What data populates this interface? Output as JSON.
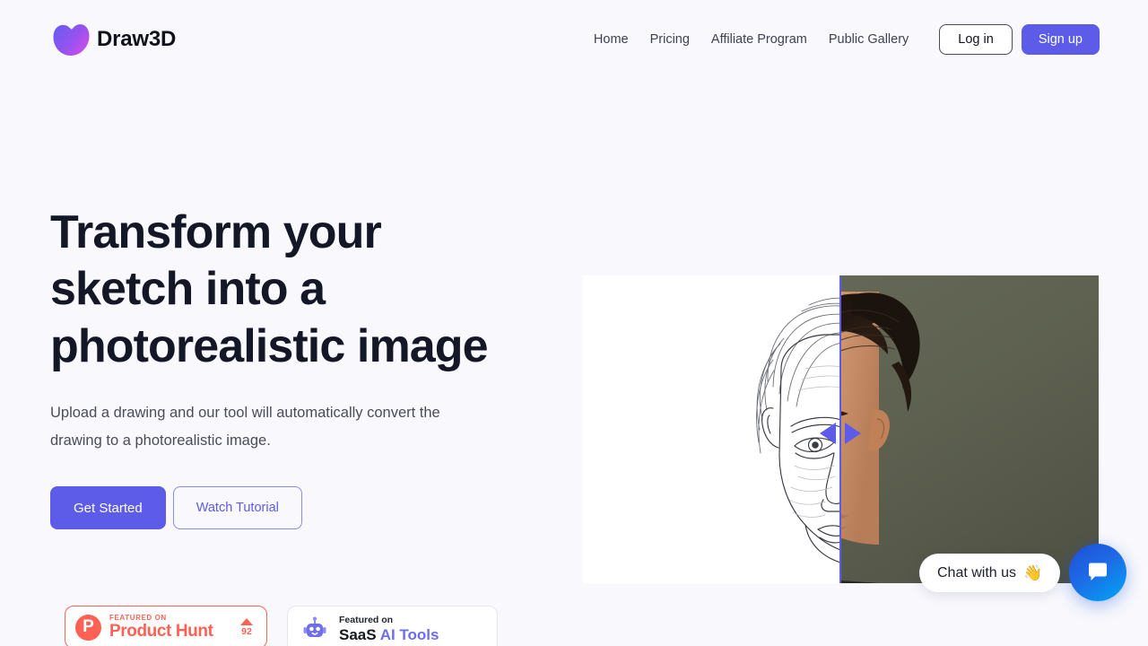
{
  "brand": {
    "name": "Draw3D",
    "logo_gradient_from": "#6a5cf0",
    "logo_gradient_to": "#d94bea"
  },
  "nav": {
    "links": [
      {
        "label": "Home"
      },
      {
        "label": "Pricing"
      },
      {
        "label": "Affiliate Program"
      },
      {
        "label": "Public Gallery"
      }
    ],
    "login_label": "Log in",
    "signup_label": "Sign up",
    "accent_color": "#5c5ce8"
  },
  "hero": {
    "title": "Transform your sketch into a photorealistic image",
    "subtitle": "Upload a drawing and our tool will automatically convert the drawing to a photorealistic image.",
    "primary_cta": "Get Started",
    "secondary_cta": "Watch Tutorial"
  },
  "comparison": {
    "before_label": "pencil sketch of a man's face",
    "after_label": "photorealistic portrait of a young man",
    "divider_color": "#5c5ce8",
    "photo_background_color": "#5d6050",
    "sketch_background_color": "#ffffff"
  },
  "badges": {
    "product_hunt": {
      "featured_text": "FEATURED ON",
      "name": "Product Hunt",
      "upvotes": "92",
      "color": "#ff6154",
      "logo_letter": "P"
    },
    "saas_ai_tools": {
      "featured_text": "Featured on",
      "name_primary": "SaaS",
      "name_accent": "AI Tools",
      "accent_color": "#6d6ded"
    }
  },
  "chat": {
    "message": "Chat with us",
    "wave_emoji": "👋",
    "button_color": "#1e6ae5"
  }
}
